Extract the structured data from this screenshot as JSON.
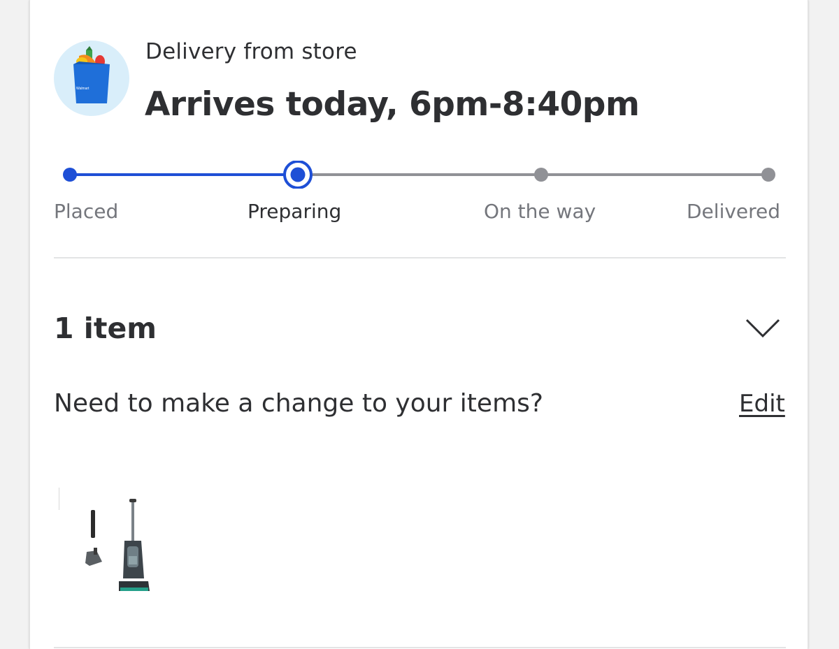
{
  "order": {
    "delivery_label": "Delivery from store",
    "arrival_title": "Arrives today, 6pm-8:40pm",
    "store_icon_text": "Walmart"
  },
  "tracker": {
    "current_step": 2,
    "steps": [
      {
        "label": "Placed"
      },
      {
        "label": "Preparing"
      },
      {
        "label": "On the way"
      },
      {
        "label": "Delivered"
      }
    ]
  },
  "items": {
    "count_label": "1 item",
    "change_question": "Need to make a change to your items?",
    "edit_label": "Edit",
    "products": [
      {
        "icon": "upright-vacuum-image"
      }
    ]
  },
  "colors": {
    "accent": "#1e4fd6",
    "inactive": "#909196",
    "text": "#2e2f32",
    "muted": "#74767c"
  }
}
